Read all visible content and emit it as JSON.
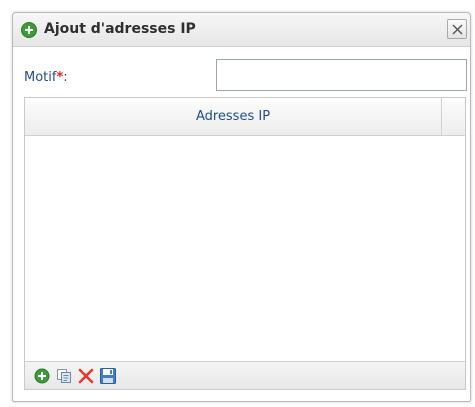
{
  "dialog": {
    "title": "Ajout d'adresses IP",
    "close_label": "X"
  },
  "form": {
    "motif_label": "Motif",
    "required_mark": "*",
    "label_suffix": ":",
    "motif_value": ""
  },
  "grid": {
    "columns": [
      "Adresses IP"
    ],
    "rows": []
  },
  "toolbar": {
    "buttons": [
      "add-icon",
      "copy-icon",
      "delete-icon",
      "save-icon"
    ]
  },
  "colors": {
    "label_blue": "#1f4d8c",
    "required_red": "#e2231a",
    "add_green": "#3f9b3a",
    "delete_red": "#e53a2c",
    "save_blue": "#3d7fcf"
  }
}
